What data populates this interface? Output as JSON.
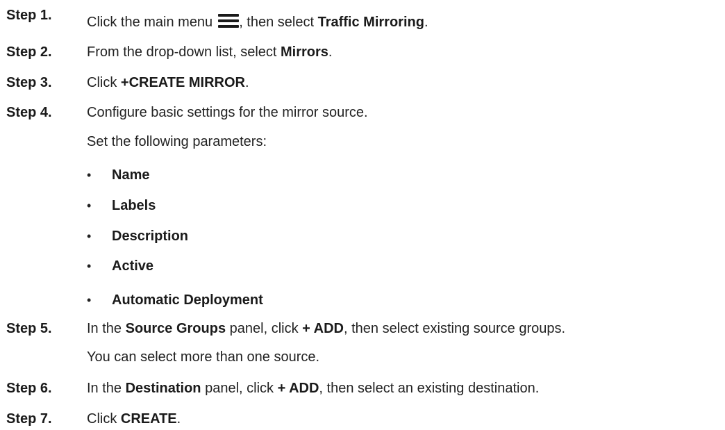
{
  "steps": [
    {
      "label": "Step 1.",
      "text": {
        "a": "Click the main menu",
        "b": ", then select ",
        "c": "Traffic Mirroring",
        "d": "."
      },
      "icon": "hamburger-menu-icon"
    },
    {
      "label": "Step 2.",
      "text": {
        "a": "From the drop-down list, select ",
        "b": "Mirrors",
        "c": "."
      }
    },
    {
      "label": "Step 3.",
      "text": {
        "a": "Click ",
        "b": "+CREATE MIRROR",
        "c": "."
      }
    },
    {
      "label": "Step 4.",
      "text": {
        "a": "Configure basic settings for the mirror source.",
        "b": "Set the following parameters:"
      },
      "bullets": [
        "Name",
        "Labels",
        "Description",
        "Active",
        "Automatic Deployment"
      ]
    },
    {
      "label": "Step 5.",
      "text": {
        "a": "In the ",
        "b": "Source Groups",
        "c": " panel, click ",
        "d": "+ ADD",
        "e": ", then select existing source groups.",
        "f": "You can select more than one source."
      }
    },
    {
      "label": "Step 6.",
      "text": {
        "a": "In the ",
        "b": "Destination",
        "c": " panel, click ",
        "d": "+ ADD",
        "e": ", then select an existing destination."
      }
    },
    {
      "label": "Step 7.",
      "text": {
        "a": "Click ",
        "b": "CREATE",
        "c": "."
      }
    }
  ]
}
